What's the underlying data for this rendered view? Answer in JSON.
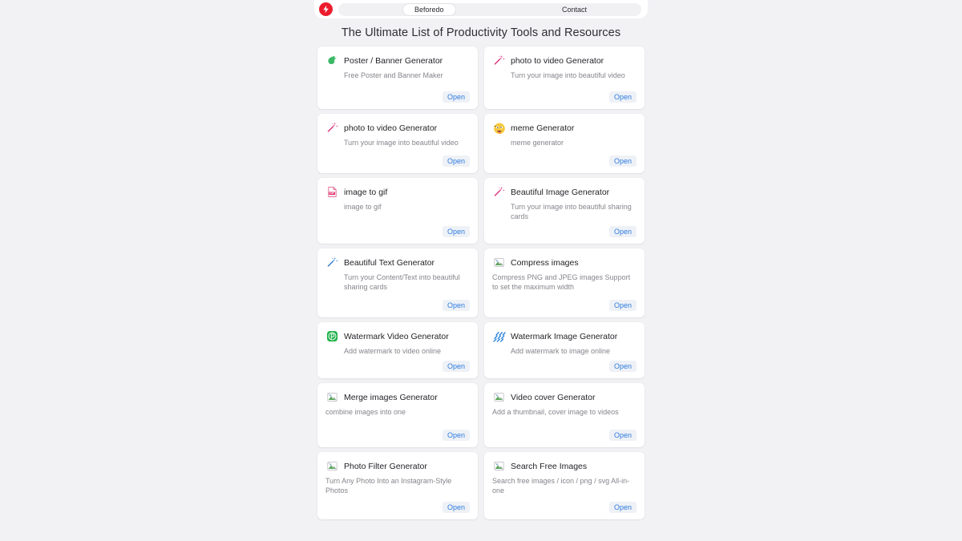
{
  "browser": {
    "brand_icon": "lightning-bolt-icon",
    "brand_color": "#ec1c2d",
    "tab_label": "Beforedo",
    "nav_label": "Contact"
  },
  "page": {
    "title": "The Ultimate List of Productivity Tools and Resources",
    "open_label": "Open"
  },
  "cards": [
    {
      "title": "Poster / Banner Generator",
      "desc": "Free Poster and Banner Maker",
      "icon": "green-paint-blob-icon",
      "open": "Open"
    },
    {
      "title": "photo to video Generator",
      "desc": "Turn your image into beautiful video",
      "icon": "pink-magic-wand-icon",
      "open": "Open"
    },
    {
      "title": "photo to video Generator",
      "desc": "Turn your image into beautiful video",
      "icon": "pink-magic-wand-icon",
      "open": "Open"
    },
    {
      "title": "meme Generator",
      "desc": "meme generator",
      "icon": "zany-face-emoji-icon",
      "open": "Open"
    },
    {
      "title": "image to gif",
      "desc": "image to gif",
      "icon": "gif-file-icon",
      "open": "Open"
    },
    {
      "title": "Beautiful Image Generator",
      "desc": "Turn your image into beautiful sharing cards",
      "icon": "pink-magic-wand-icon",
      "open": "Open"
    },
    {
      "title": "Beautiful Text Generator",
      "desc": "Turn your Content/Text into beautiful sharing cards",
      "icon": "blue-magic-wand-icon",
      "open": "Open"
    },
    {
      "title": "Compress images",
      "desc": "Compress PNG and JPEG images Support to set the maximum width",
      "icon": "broken-image-icon",
      "open": "Open"
    },
    {
      "title": "Watermark Video Generator",
      "desc": "Add watermark to video online",
      "icon": "green-p-badge-icon",
      "open": "Open"
    },
    {
      "title": "Watermark Image Generator",
      "desc": "Add watermark to image online",
      "icon": "blue-diagonal-stripes-icon",
      "open": "Open"
    },
    {
      "title": "Merge images Generator",
      "desc": "combine images into one",
      "icon": "broken-image-icon",
      "open": "Open"
    },
    {
      "title": "Video cover Generator",
      "desc": "Add a thumbnail, cover image to videos",
      "icon": "broken-image-icon",
      "open": "Open"
    },
    {
      "title": "Photo Filter Generator",
      "desc": "Turn Any Photo Into an Instagram-Style Photos",
      "icon": "broken-image-icon",
      "open": "Open"
    },
    {
      "title": "Search Free Images",
      "desc": "Search free images / icon / png / svg All-in-one",
      "icon": "broken-image-icon",
      "open": "Open"
    }
  ]
}
